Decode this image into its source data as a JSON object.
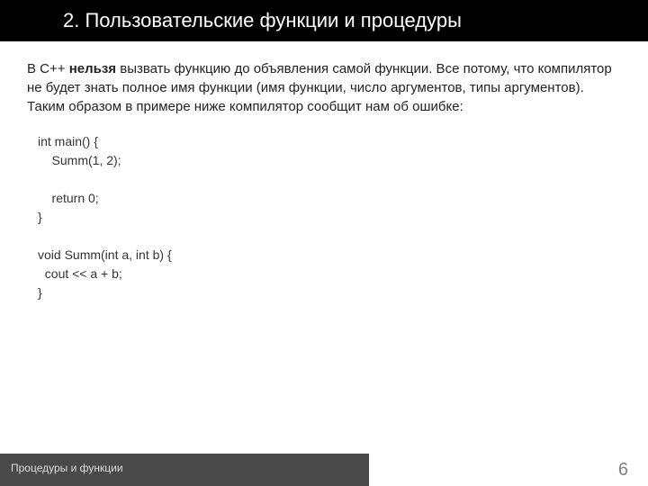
{
  "header": {
    "title": "2. Пользовательские функции и процедуры"
  },
  "body": {
    "para_prefix": "В C++ ",
    "para_bold": "нельзя",
    "para_suffix": " вызвать функцию до объявления самой функции. Все потому, что компилятор не будет знать полное имя функции (имя функции, число аргументов, типы аргументов). Таким образом в примере ниже компилятор сообщит нам об ошибке:",
    "code": {
      "l1": "int main() {",
      "l2": "    Summ(1, 2);",
      "l3": " ",
      "l4": "    return 0;",
      "l5": "}",
      "l6": " ",
      "l7": "void Summ(int a, int b) {",
      "l8": "  cout << a + b;",
      "l9": "}"
    }
  },
  "footer": {
    "label": "Процедуры и функции",
    "page": "6"
  }
}
